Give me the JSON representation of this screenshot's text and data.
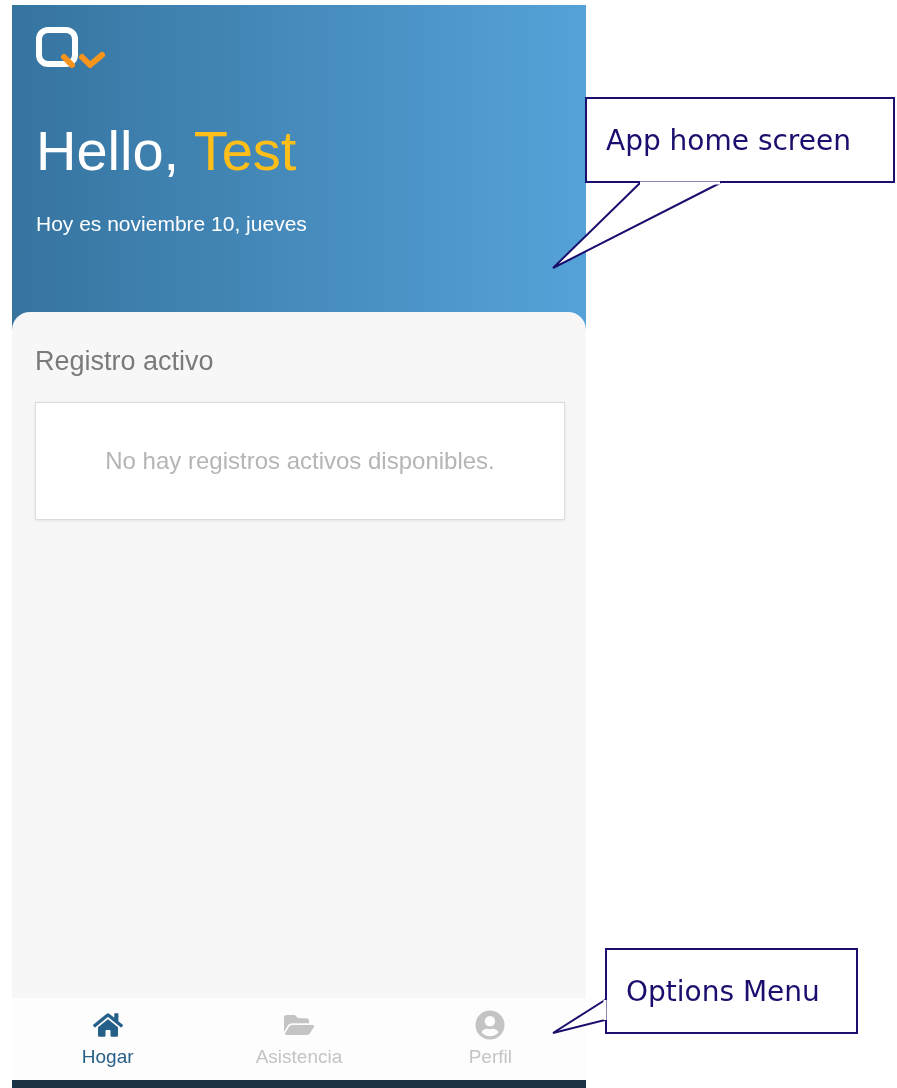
{
  "header": {
    "greeting": "Hello,",
    "name": "Test",
    "date": "Hoy es noviembre 10, jueves"
  },
  "section": {
    "title": "Registro activo",
    "empty_message": "No hay registros activos disponibles."
  },
  "nav": [
    {
      "label": "Hogar",
      "selected": true
    },
    {
      "label": "Asistencia",
      "selected": false
    },
    {
      "label": "Perfil",
      "selected": false
    }
  ],
  "annotations": [
    {
      "text": "App home screen"
    },
    {
      "text": "Options Menu"
    }
  ]
}
